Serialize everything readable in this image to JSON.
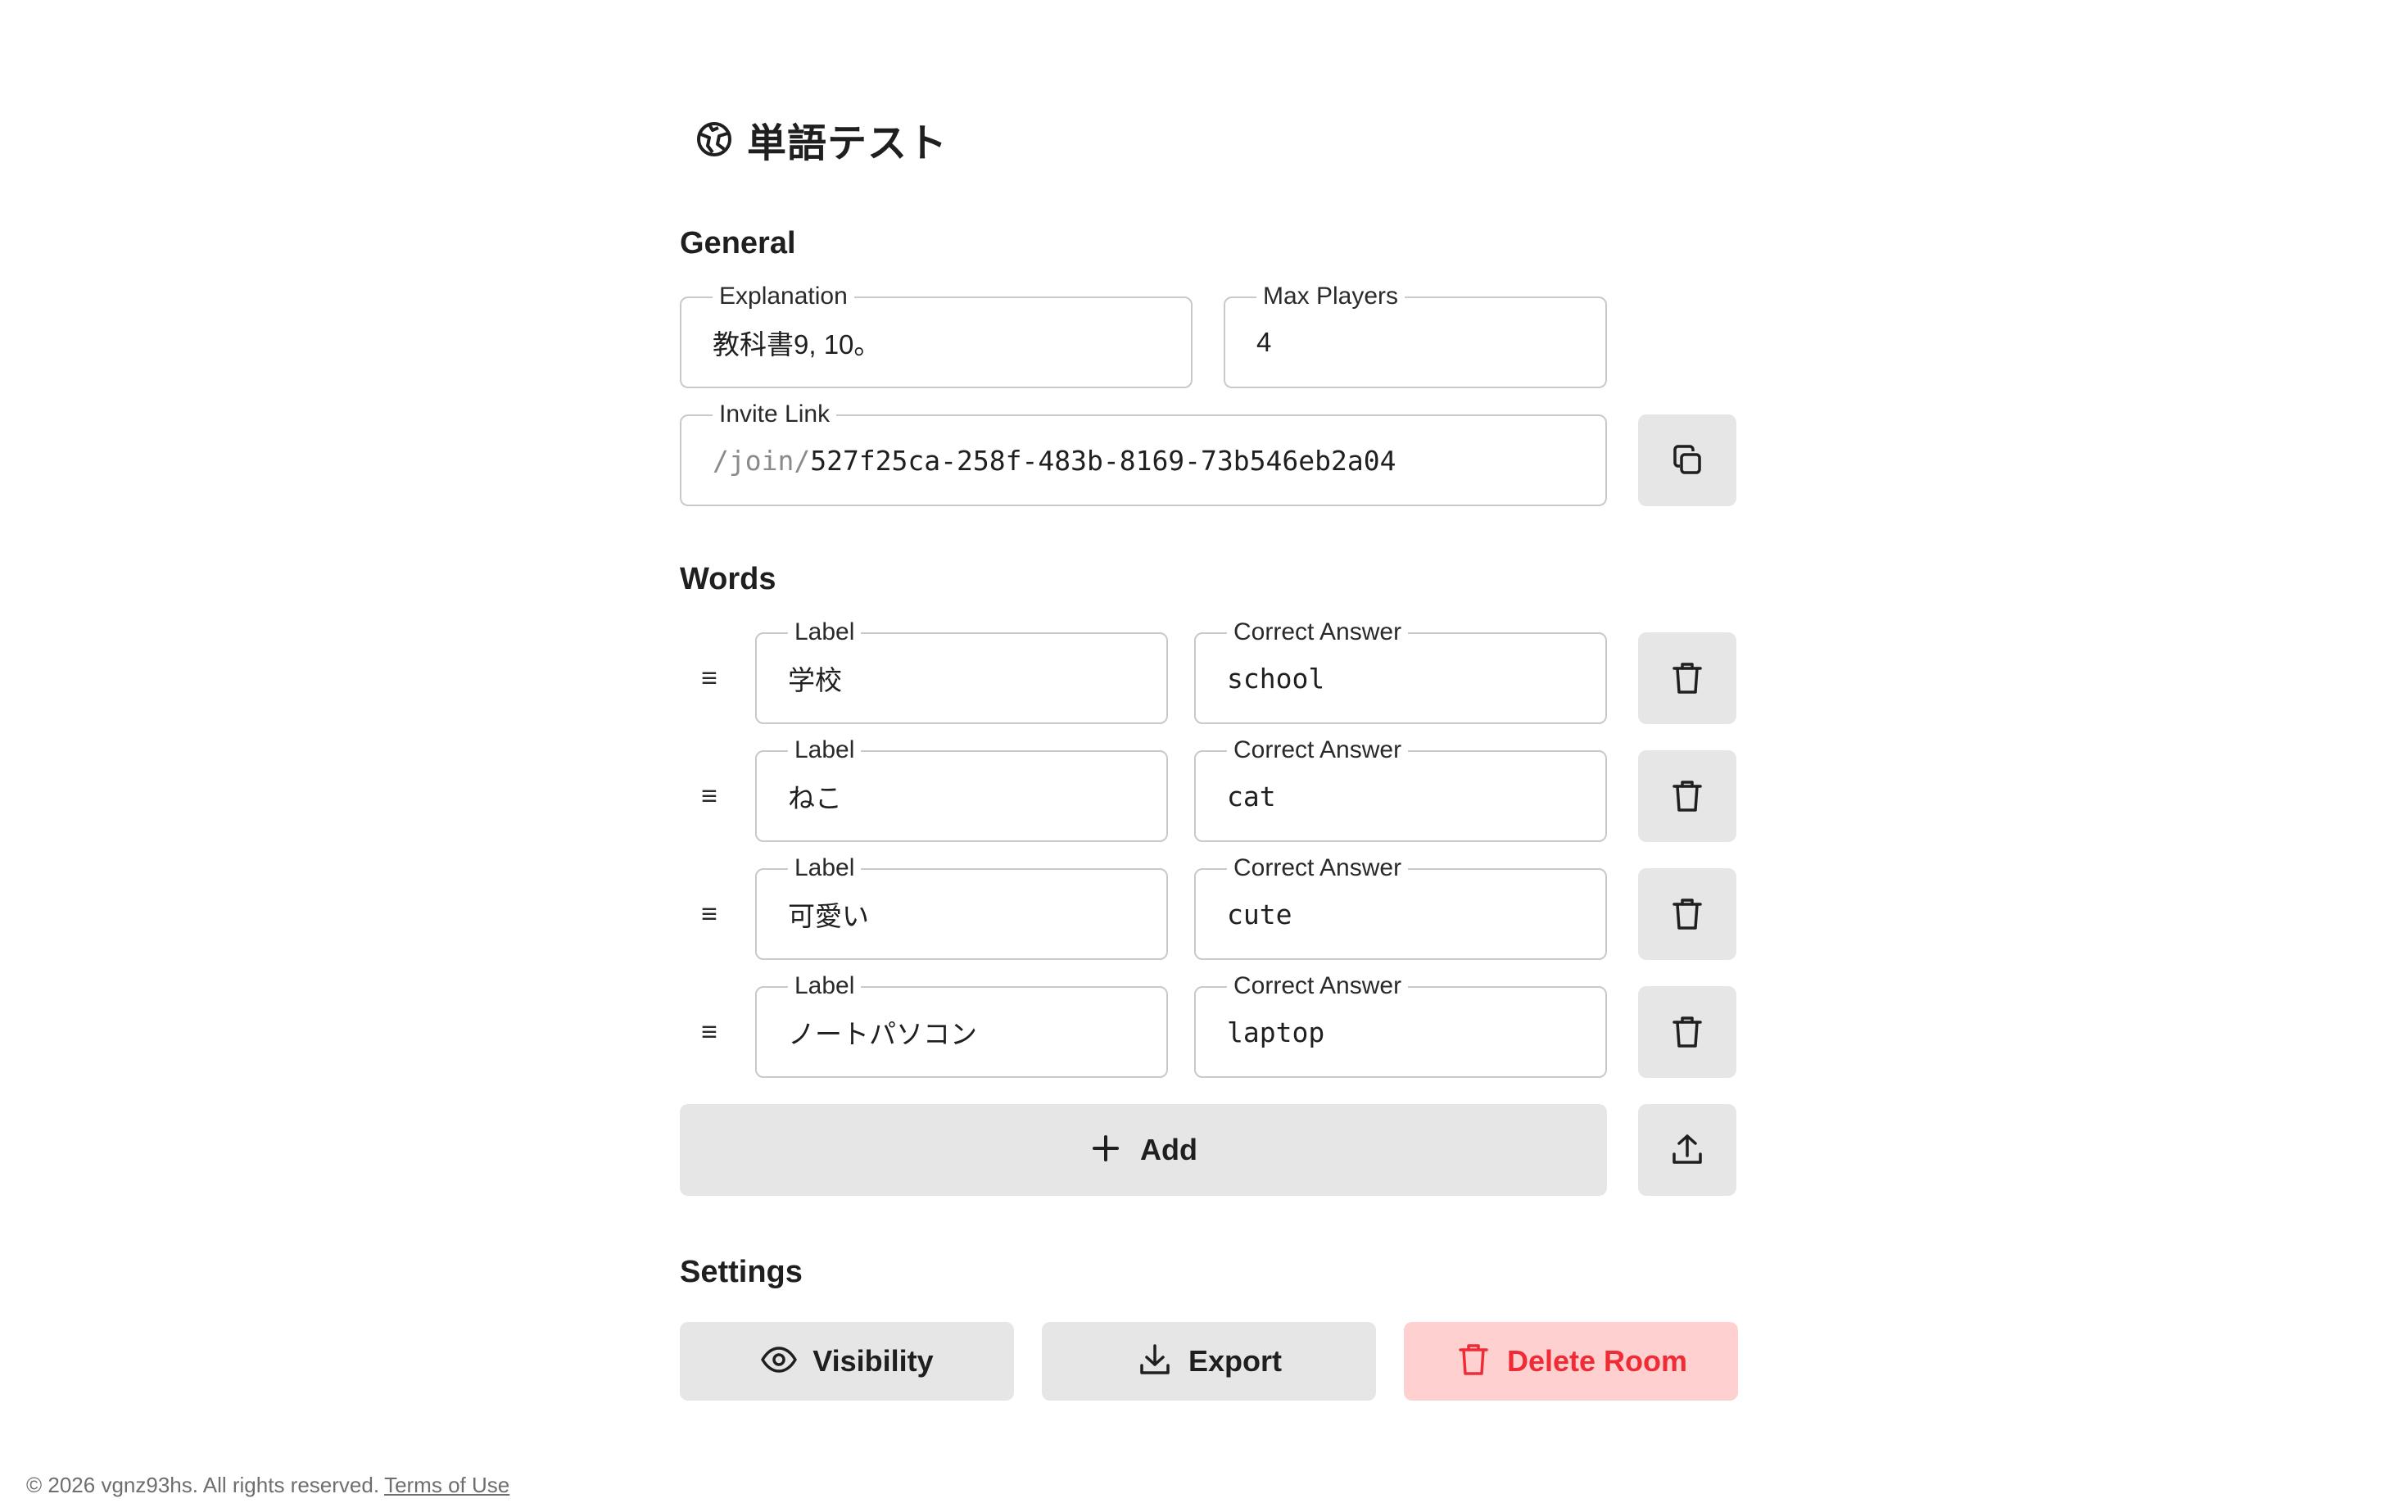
{
  "app": {
    "title": "単語テスト",
    "logo_icon": "globe-icon"
  },
  "general": {
    "heading": "General",
    "explanation": {
      "label": "Explanation",
      "value": "教科書9, 10。"
    },
    "max_players": {
      "label": "Max Players",
      "value": "4"
    },
    "invite_link": {
      "label": "Invite Link",
      "prefix": "/join/",
      "value": "527f25ca-258f-483b-8169-73b546eb2a04",
      "copy_icon": "copy-icon"
    }
  },
  "words": {
    "heading": "Words",
    "items": [
      {
        "label_caption": "Label",
        "label": "学校",
        "answer_caption": "Correct Answer",
        "answer": "school"
      },
      {
        "label_caption": "Label",
        "label": "ねこ",
        "answer_caption": "Correct Answer",
        "answer": "cat"
      },
      {
        "label_caption": "Label",
        "label": "可愛い",
        "answer_caption": "Correct Answer",
        "answer": "cute"
      },
      {
        "label_caption": "Label",
        "label": "ノートパソコン",
        "answer_caption": "Correct Answer",
        "answer": "laptop"
      }
    ],
    "drag_handle_glyph": "≡",
    "add_label": "Add",
    "upload_icon": "upload-icon"
  },
  "settings": {
    "heading": "Settings",
    "visibility_label": "Visibility",
    "export_label": "Export",
    "delete_label": "Delete Room"
  },
  "footer": {
    "copyright": "© 2026 vgnz93hs. All rights reserved.",
    "terms_label": "Terms of Use"
  },
  "colors": {
    "button_bg": "#e6e6e6",
    "danger_bg": "#ffd0d0",
    "danger_text": "#ef2b35",
    "border": "#c9c9c9"
  }
}
